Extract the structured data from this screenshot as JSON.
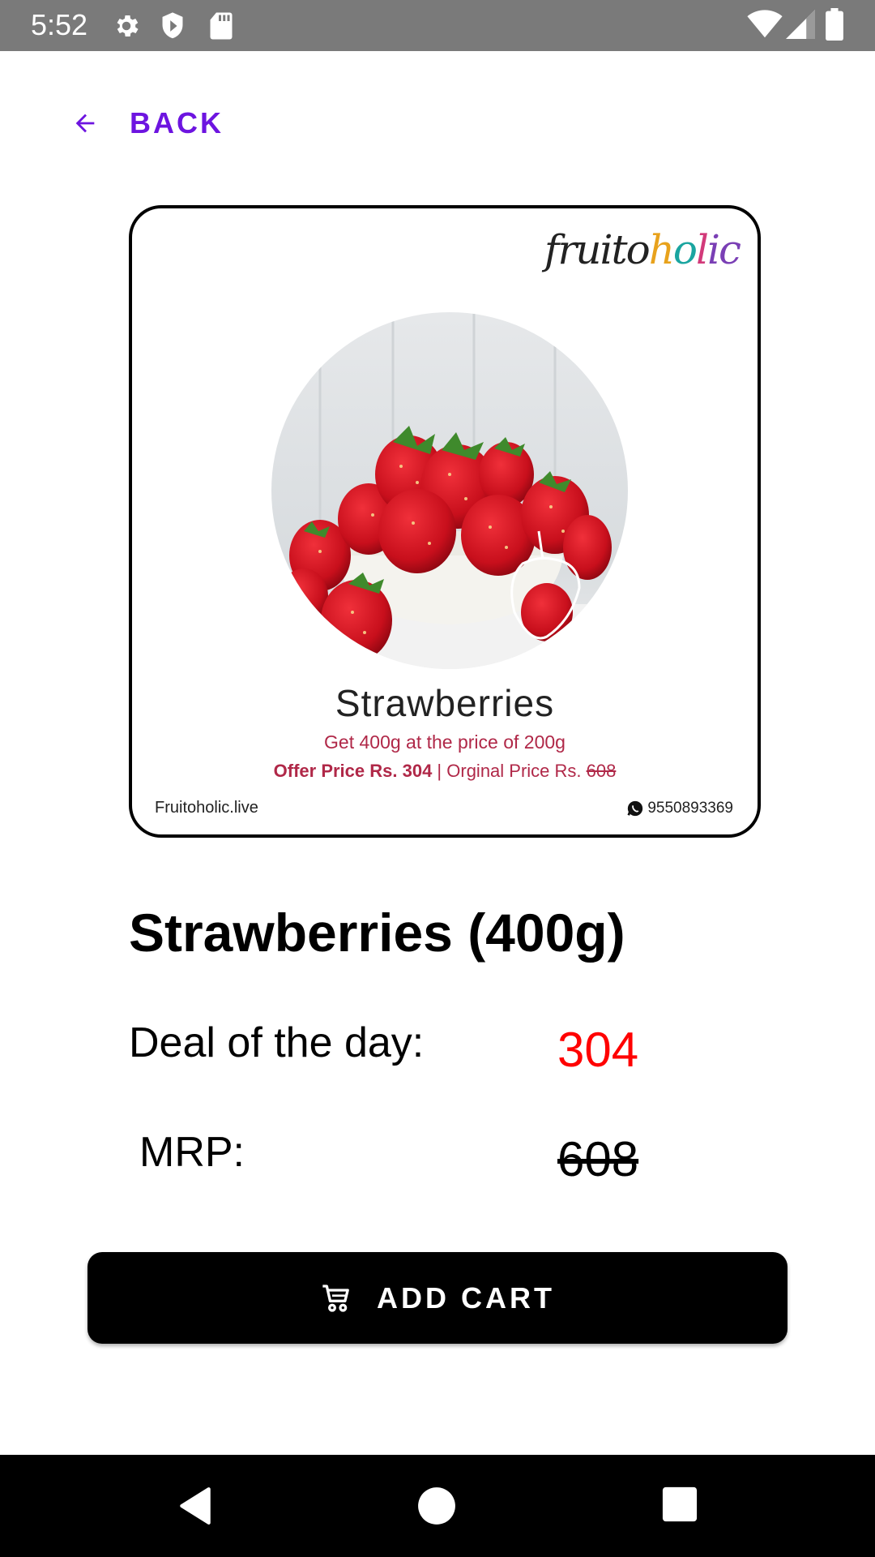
{
  "status_bar": {
    "time": "5:52",
    "icons": [
      "gear-icon",
      "shield-icon",
      "sd-card-icon",
      "wifi-icon",
      "signal-icon",
      "battery-icon"
    ]
  },
  "header": {
    "back_label": "BACK",
    "accent_color": "#6d14e0"
  },
  "product_image": {
    "brand": {
      "part1": "fruito",
      "part2": "h",
      "part3": "o",
      "part4": "l",
      "part5": "ic"
    },
    "title": "Strawberries",
    "promo": "Get 400g at the price of 200g",
    "offer_prefix": "Offer Price Rs. 304",
    "offer_separator": " | Orginal Price Rs. ",
    "offer_struck": "608",
    "site": "Fruitoholic.live",
    "phone": "9550893369"
  },
  "product": {
    "name": "Strawberries (400g)",
    "deal_label": "Deal of the day:",
    "deal_value": "304",
    "deal_color": "#ff0000",
    "mrp_label": "MRP:",
    "mrp_value": "608"
  },
  "actions": {
    "add_cart_label": "ADD CART"
  },
  "nav_bar": {
    "buttons": [
      "back-triangle-icon",
      "home-circle-icon",
      "recents-square-icon"
    ]
  }
}
